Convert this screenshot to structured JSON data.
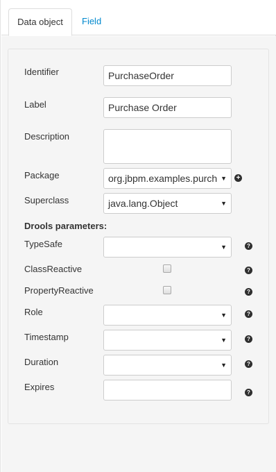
{
  "tabs": [
    {
      "label": "Data object",
      "active": true
    },
    {
      "label": "Field",
      "active": false
    }
  ],
  "form": {
    "identifier": {
      "label": "Identifier",
      "value": "PurchaseOrder"
    },
    "label": {
      "label": "Label",
      "value": "Purchase Order"
    },
    "description": {
      "label": "Description",
      "value": ""
    },
    "package": {
      "label": "Package",
      "value": "org.jbpm.examples.purch"
    },
    "superclass": {
      "label": "Superclass",
      "value": "java.lang.Object"
    }
  },
  "drools": {
    "heading": "Drools parameters:",
    "typesafe": {
      "label": "TypeSafe",
      "value": ""
    },
    "classreactive": {
      "label": "ClassReactive",
      "checked": false
    },
    "propertyreactive": {
      "label": "PropertyReactive",
      "checked": false
    },
    "role": {
      "label": "Role",
      "value": ""
    },
    "timestamp": {
      "label": "Timestamp",
      "value": ""
    },
    "duration": {
      "label": "Duration",
      "value": ""
    },
    "expires": {
      "label": "Expires",
      "value": ""
    }
  },
  "icons": {
    "caret": "▼",
    "help": "?",
    "add": "+"
  },
  "colors": {
    "link": "#0088ce",
    "panel_bg": "#f5f5f5"
  }
}
